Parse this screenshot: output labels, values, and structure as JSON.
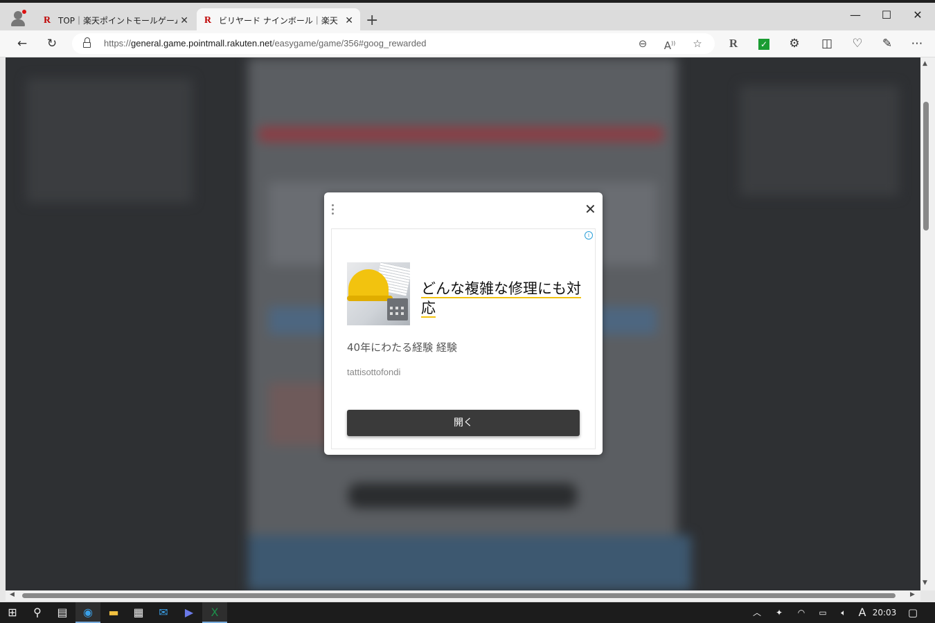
{
  "tabs": [
    {
      "title": "TOP｜楽天ポイントモールゲームセンター",
      "favicon": "R",
      "active": false
    },
    {
      "title": "ビリヤード ナインボール｜楽天ポイントモール",
      "favicon": "R",
      "active": true
    }
  ],
  "window_controls": {
    "minimize": "—",
    "maximize": "☐",
    "close": "✕"
  },
  "address_bar": {
    "url_prefix": "https://",
    "url_host": "general.game.pointmall.rakuten.net",
    "url_path": "/easygame/game/356#goog_rewarded"
  },
  "toolbar_icons": [
    "back-icon",
    "refresh-icon",
    "zoom-out-icon",
    "read-aloud-icon",
    "favorite-star-icon",
    "rakuten-extension-icon",
    "checkmark-extension-icon",
    "extensions-icon",
    "split-screen-icon",
    "browser-essentials-icon",
    "copilot-icon",
    "more-icon"
  ],
  "ad": {
    "headline": "どんな複雑な修理にも対応",
    "description": "40年にわたる経験 経験",
    "advertiser": "tattisottofondi",
    "button_label": "開く",
    "info_glyph": "i"
  },
  "taskbar": {
    "time": "20:03",
    "ime": "A"
  },
  "colors": {
    "overlay": "#2e3033",
    "ad_button": "#3a3a3a",
    "highlight": "#f2c30f"
  }
}
